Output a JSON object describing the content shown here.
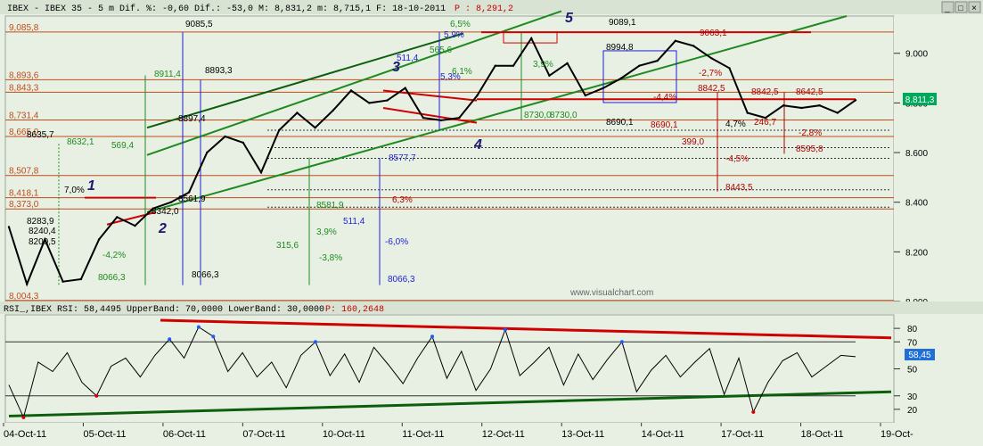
{
  "header": {
    "title": "IBEX - IBEX 35 - 5 m Dif. %: -0,60 Dif.: -53,0 M: 8,831,2 m: 8,715,1 F: 18-10-2011",
    "p_label": "P : 8,291,2",
    "buttons": [
      "_",
      "□",
      "×"
    ]
  },
  "rsi_header": {
    "title": "RSI_,IBEX RSI: 58,4495 UpperBand: 70,0000 LowerBand: 30,0000",
    "p_label": "P: 160,2648"
  },
  "watermark": "www.visualchart.com",
  "colors": {
    "background": "#e7f0e3",
    "price_line": "#000000",
    "rsi_line": "#000000",
    "rsi_extreme": "#1e5bff",
    "resistance": "#d10000",
    "channel": "#1f8a1f",
    "level_red": "#c24b1a"
  },
  "chart_data": [
    {
      "type": "line",
      "title": "IBEX 35 - 5 m",
      "ylim": [
        8000,
        9150
      ],
      "y_ticks": [
        "9.000",
        "8.800",
        "8.600",
        "8.400",
        "8.200",
        "8.000"
      ],
      "y_tick_values": [
        9000,
        8800,
        8600,
        8400,
        8200,
        8000
      ],
      "current_value": "8.811,3",
      "x_labels": [
        "04-Oct-11",
        "05-Oct-11",
        "06-Oct-11",
        "07-Oct-11",
        "10-Oct-11",
        "11-Oct-11",
        "12-Oct-11",
        "13-Oct-11",
        "14-Oct-11",
        "17-Oct-11",
        "18-Oct-11",
        "19-Oct-"
      ],
      "series": [
        {
          "values": [
            8300,
            8070,
            8250,
            8080,
            8090,
            8250,
            8340,
            8305,
            8375,
            8400,
            8440,
            8600,
            8665,
            8640,
            8520,
            8690,
            8760,
            8700,
            8770,
            8850,
            8800,
            8810,
            8860,
            8740,
            8730,
            8740,
            8830,
            8950,
            8950,
            9060,
            8910,
            8960,
            8830,
            8860,
            8900,
            8950,
            8970,
            9050,
            9030,
            8980,
            8940,
            8760,
            8740,
            8790,
            8780,
            8790,
            8760,
            8811
          ]
        }
      ],
      "horizontal_levels": [
        {
          "label": "9,085,8",
          "value": 9085.8
        },
        {
          "label": "8,893,6",
          "value": 8893.6
        },
        {
          "label": "8,843,3",
          "value": 8843.3
        },
        {
          "label": "8,731,4",
          "value": 8731.4
        },
        {
          "label": "8,665,0",
          "value": 8665.0
        },
        {
          "label": "8,507,8",
          "value": 8507.8
        },
        {
          "label": "8,418,1",
          "value": 8418.1
        },
        {
          "label": "8,373,0",
          "value": 8373.0
        },
        {
          "label": "8,004,3",
          "value": 8004.3
        }
      ],
      "wave_labels": [
        "1",
        "2",
        "3",
        "4",
        "5"
      ],
      "annotations": [
        "9085,5",
        "8893,3",
        "8911,4",
        "569,4",
        "8897,4",
        "8632,1",
        "8635,7",
        "8577,7",
        "511,4",
        "-6,0%",
        "315,6",
        "3,9%",
        "-3,8%",
        "8066,3",
        "8066,3",
        "8066,3",
        "8561,9",
        "8581,9",
        "6,3%",
        "8342,0",
        "8283,9",
        "8240,4",
        "8200,5",
        "-4,2%",
        "7,0%",
        "5,9%",
        "6,5%",
        "5,3%",
        "6,1%",
        "565,6",
        "511,4",
        "8730,0",
        "8730,0",
        "8690,1",
        "8690,1",
        "9089,1",
        "8994,8",
        "-4,4%",
        "-2,7%",
        "8842,5",
        "8842,5",
        "8642,5",
        "4,7%",
        "246,7",
        "-2,8%",
        "8595,8",
        "399,0",
        "-4,5%",
        "8443,5",
        "9063,1",
        "3,9%"
      ]
    },
    {
      "type": "line",
      "title": "RSI",
      "ylim": [
        10,
        90
      ],
      "y_ticks": [
        "80",
        "70",
        "50",
        "30",
        "20"
      ],
      "y_tick_values": [
        80,
        70,
        50,
        30,
        20
      ],
      "upper_band": 70,
      "lower_band": 30,
      "current_value": "58,45",
      "series": [
        {
          "values": [
            38,
            14,
            55,
            48,
            62,
            40,
            30,
            52,
            58,
            44,
            60,
            72,
            58,
            81,
            74,
            48,
            62,
            44,
            55,
            36,
            60,
            70,
            45,
            61,
            40,
            66,
            53,
            39,
            58,
            74,
            43,
            63,
            34,
            50,
            79,
            45,
            55,
            66,
            38,
            61,
            42,
            57,
            70,
            33,
            49,
            60,
            44,
            55,
            65,
            31,
            58,
            18,
            40,
            56,
            62,
            44,
            52,
            60,
            59
          ]
        }
      ]
    }
  ]
}
